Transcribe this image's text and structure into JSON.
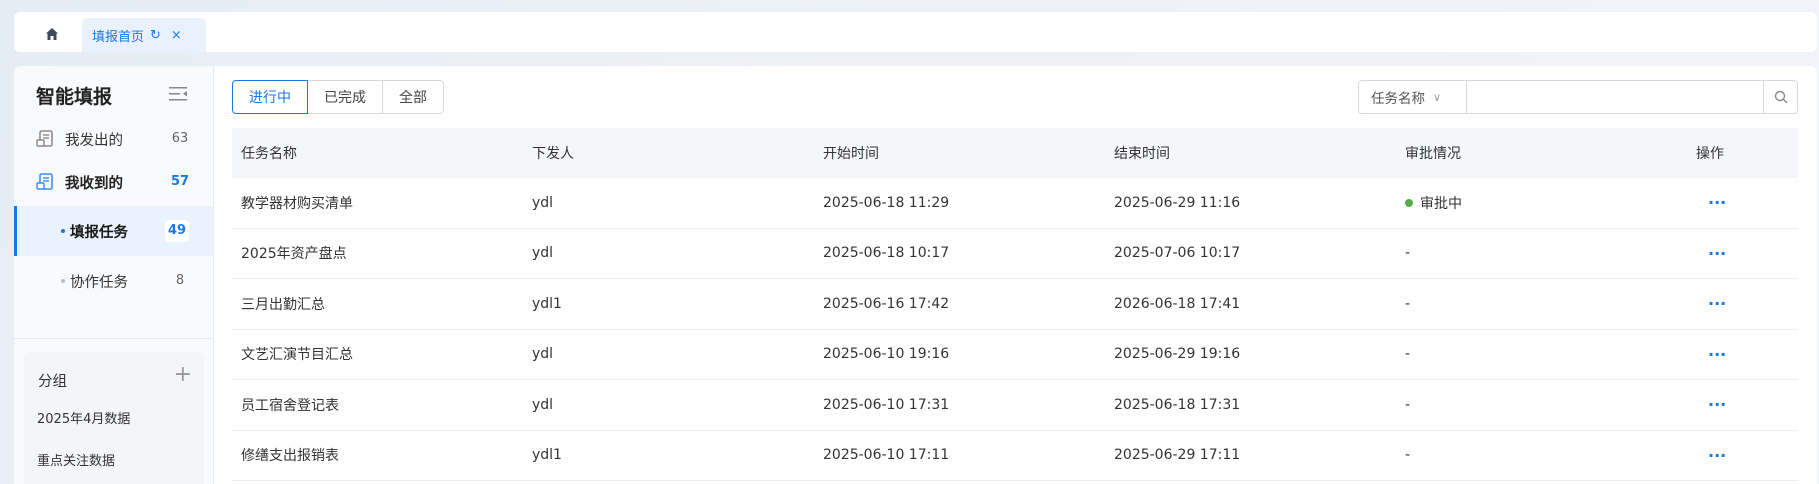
{
  "tabs": {
    "home_icon": "home-icon",
    "active_label": "填报首页",
    "reload_icon": "↻",
    "close_icon": "×"
  },
  "sidebar": {
    "title": "智能填报",
    "items": [
      {
        "label": "我发出的",
        "count": "63"
      },
      {
        "label": "我收到的",
        "count": "57"
      },
      {
        "label": "填报任务",
        "count": "49"
      },
      {
        "label": "协作任务",
        "count": "8"
      }
    ],
    "group": {
      "title": "分组",
      "add": "+",
      "items": [
        "2025年4月数据",
        "重点关注数据"
      ]
    }
  },
  "main": {
    "segments": [
      "进行中",
      "已完成",
      "全部"
    ],
    "search": {
      "type_label": "任务名称",
      "chevron": "∨",
      "placeholder": ""
    },
    "table": {
      "headers": [
        "任务名称",
        "下发人",
        "开始时间",
        "结束时间",
        "审批情况",
        "操作"
      ],
      "rows": [
        {
          "name": "教学器材购买清单",
          "issuer": "ydl",
          "start": "2025-06-18 11:29",
          "end": "2025-06-29 11:16",
          "status": "审批中",
          "action": "···"
        },
        {
          "name": "2025年资产盘点",
          "issuer": "ydl",
          "start": "2025-06-18 10:17",
          "end": "2025-07-06 10:17",
          "status": "-",
          "action": "···"
        },
        {
          "name": "三月出勤汇总",
          "issuer": "ydl1",
          "start": "2025-06-16 17:42",
          "end": "2026-06-18 17:41",
          "status": "-",
          "action": "···"
        },
        {
          "name": "文艺汇演节目汇总",
          "issuer": "ydl",
          "start": "2025-06-10 19:16",
          "end": "2025-06-29 19:16",
          "status": "-",
          "action": "···"
        },
        {
          "name": "员工宿舍登记表",
          "issuer": "ydl",
          "start": "2025-06-10 17:31",
          "end": "2025-06-18 17:31",
          "status": "-",
          "action": "···"
        },
        {
          "name": "修缮支出报销表",
          "issuer": "ydl1",
          "start": "2025-06-10 17:11",
          "end": "2025-06-29 17:11",
          "status": "-",
          "action": "···"
        }
      ]
    }
  },
  "colors": {
    "accent": "#1a78e5",
    "status_active": "#52b043"
  }
}
